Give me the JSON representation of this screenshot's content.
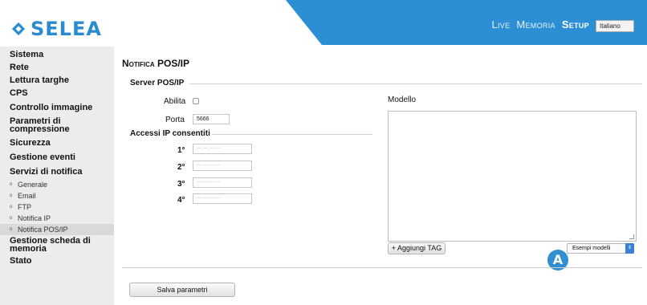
{
  "brand": {
    "name": "SELEA",
    "color": "#2a8bd0"
  },
  "topnav": {
    "live": "Live",
    "memoria": "Memoria",
    "setup": "Setup"
  },
  "language": {
    "selected": "Italiano"
  },
  "sidebar": {
    "sistema": "Sistema",
    "rete": "Rete",
    "lettura_targhe": "Lettura targhe",
    "cps": "CPS",
    "controllo_immagine": "Controllo immagine",
    "parametri_line1": "Parametri di",
    "parametri_line2": "compressione",
    "sicurezza": "Sicurezza",
    "gestione_eventi": "Gestione eventi",
    "servizi_notifica": "Servizi di notifica",
    "sub": [
      "Generale",
      "Email",
      "FTP",
      "Notifica IP",
      "Notifica POS/IP"
    ],
    "gestione_scheda_line1": "Gestione scheda di",
    "gestione_scheda_line2": "memoria",
    "stato": "Stato"
  },
  "main": {
    "title": "Notifica POS/IP",
    "server_section": "Server POS/IP",
    "abilita_label": "Abilita",
    "porta_label": "Porta",
    "porta_value": "5666",
    "accessi_section": "Accessi IP consentiti",
    "ip_rows": [
      {
        "label": "1°",
        "placeholder": "---.---.---.---"
      },
      {
        "label": "2°",
        "placeholder": "---.---.---.---"
      },
      {
        "label": "3°",
        "placeholder": "---.---.---.---"
      },
      {
        "label": "4°",
        "placeholder": "---.---.---.---"
      }
    ],
    "modello_label": "Modello",
    "add_tag_button": "+ Aggiungi TAG",
    "esempi_select": "Esempi modelli",
    "badge": "A",
    "save_button": "Salva parametri"
  },
  "colors": {
    "accent": "#2c8fd3",
    "sidebar_bg": "#ececec"
  }
}
